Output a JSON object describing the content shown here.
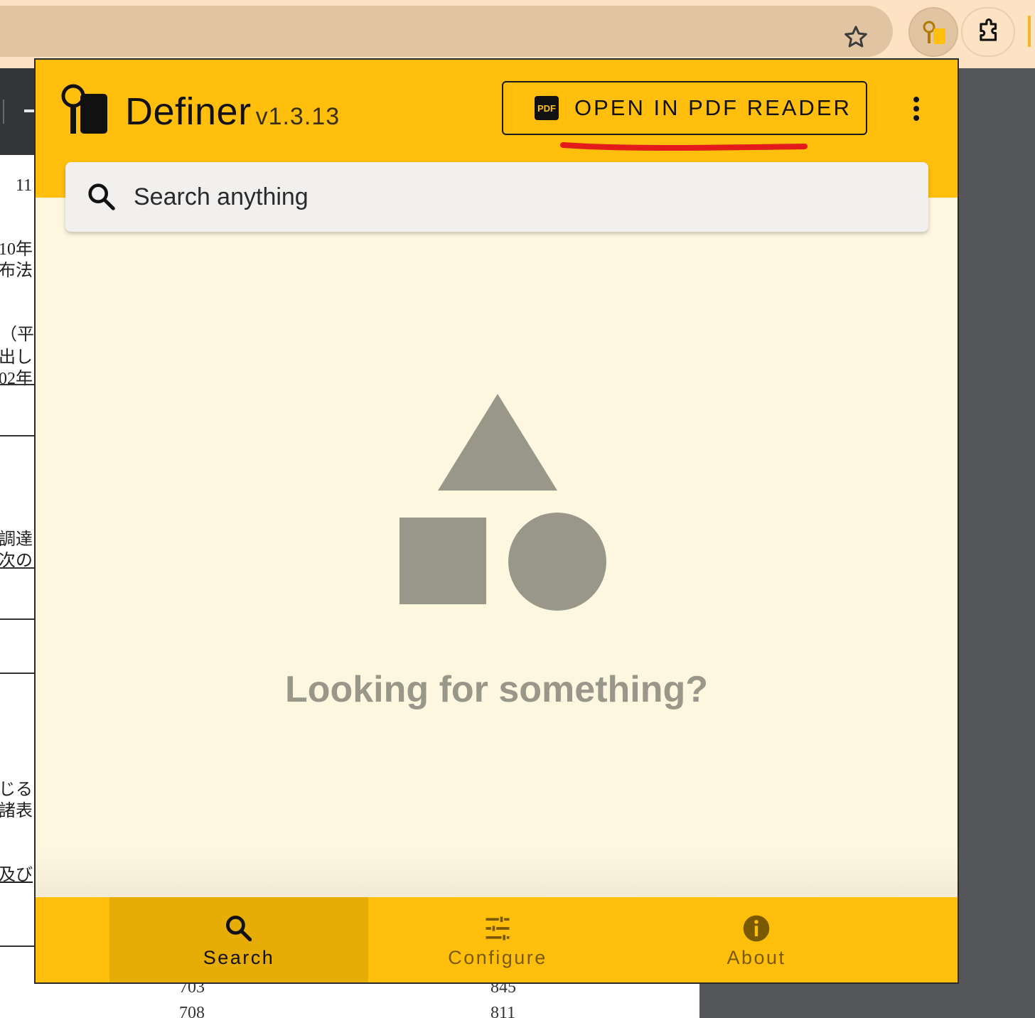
{
  "app": {
    "name": "Definer",
    "version": "v1.3.13"
  },
  "header": {
    "pdf_button_label": "OPEN IN PDF READER",
    "pdf_badge_text": "PDF"
  },
  "search": {
    "placeholder": "Search anything"
  },
  "empty_state": {
    "message": "Looking for something?"
  },
  "bottom_nav": {
    "items": [
      {
        "label": "Search",
        "icon": "search-icon",
        "active": true
      },
      {
        "label": "Configure",
        "icon": "sliders-icon",
        "active": false
      },
      {
        "label": "About",
        "icon": "info-icon",
        "active": false
      }
    ]
  },
  "background_pdf": {
    "fragments": [
      "11",
      "10年",
      "布法",
      "（平",
      "出し",
      "02年",
      "調達",
      "次の",
      "じる",
      "諸表",
      "及び",
      "（"
    ],
    "numbers": [
      "703",
      "845",
      "708",
      "811"
    ]
  },
  "colors": {
    "accent": "#ffbf0c",
    "accent_active": "#e6ac07",
    "panel_bg": "#fef7e0",
    "shape_gray": "#99978a",
    "annotation_red": "#e31b1b"
  }
}
